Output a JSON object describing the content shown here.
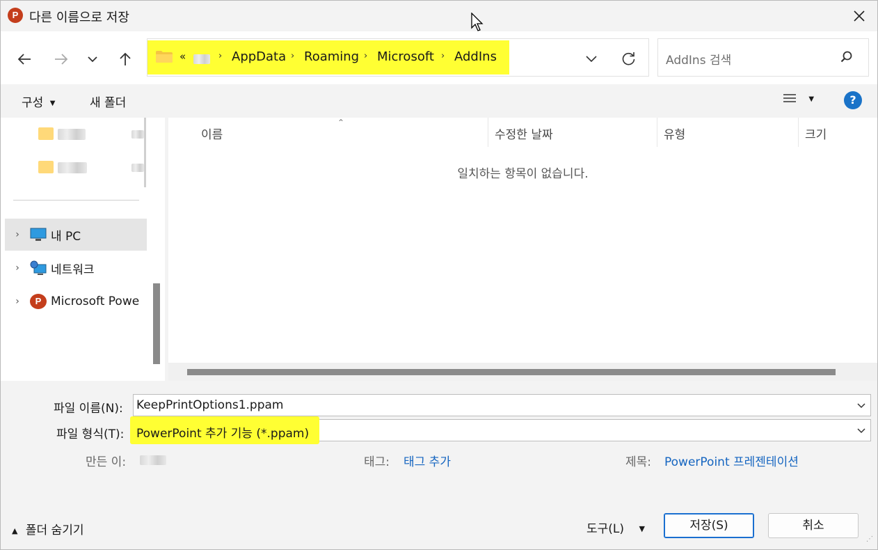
{
  "window": {
    "title": "다른 이름으로 저장",
    "app_icon_letter": "P"
  },
  "address_bar": {
    "overflow": "«",
    "crumbs": [
      "AppData",
      "Roaming",
      "Microsoft",
      "AddIns"
    ],
    "highlight_color": "#ffff33"
  },
  "search": {
    "placeholder": "AddIns 검색"
  },
  "toolbar": {
    "organize_label": "구성",
    "new_folder_label": "새 폴더"
  },
  "nav_pane": {
    "items": [
      {
        "label": "내 PC",
        "icon": "computer-icon"
      },
      {
        "label": "네트워크",
        "icon": "network-icon"
      },
      {
        "label": "Microsoft Powe",
        "icon": "powerpoint-icon"
      }
    ]
  },
  "file_list": {
    "columns": [
      "이름",
      "수정한 날짜",
      "유형",
      "크기"
    ],
    "empty_message": "일치하는 항목이 없습니다."
  },
  "form": {
    "filename_label": "파일 이름(N):",
    "filename_value": "KeepPrintOptions1.ppam",
    "filetype_label": "파일 형식(T):",
    "filetype_value": "PowerPoint 추가 기능 (*.ppam)",
    "author_label": "만든 이:",
    "tags_label": "태그:",
    "tags_value": "태그 추가",
    "title_label": "제목:",
    "title_value": "PowerPoint 프레젠테이션"
  },
  "footer": {
    "hide_folders_label": "폴더 숨기기",
    "tools_label": "도구(L)",
    "save_label": "저장(S)",
    "cancel_label": "취소"
  },
  "colors": {
    "accent": "#1a6fd0",
    "highlight": "#ffff33",
    "link": "#1565c0"
  }
}
